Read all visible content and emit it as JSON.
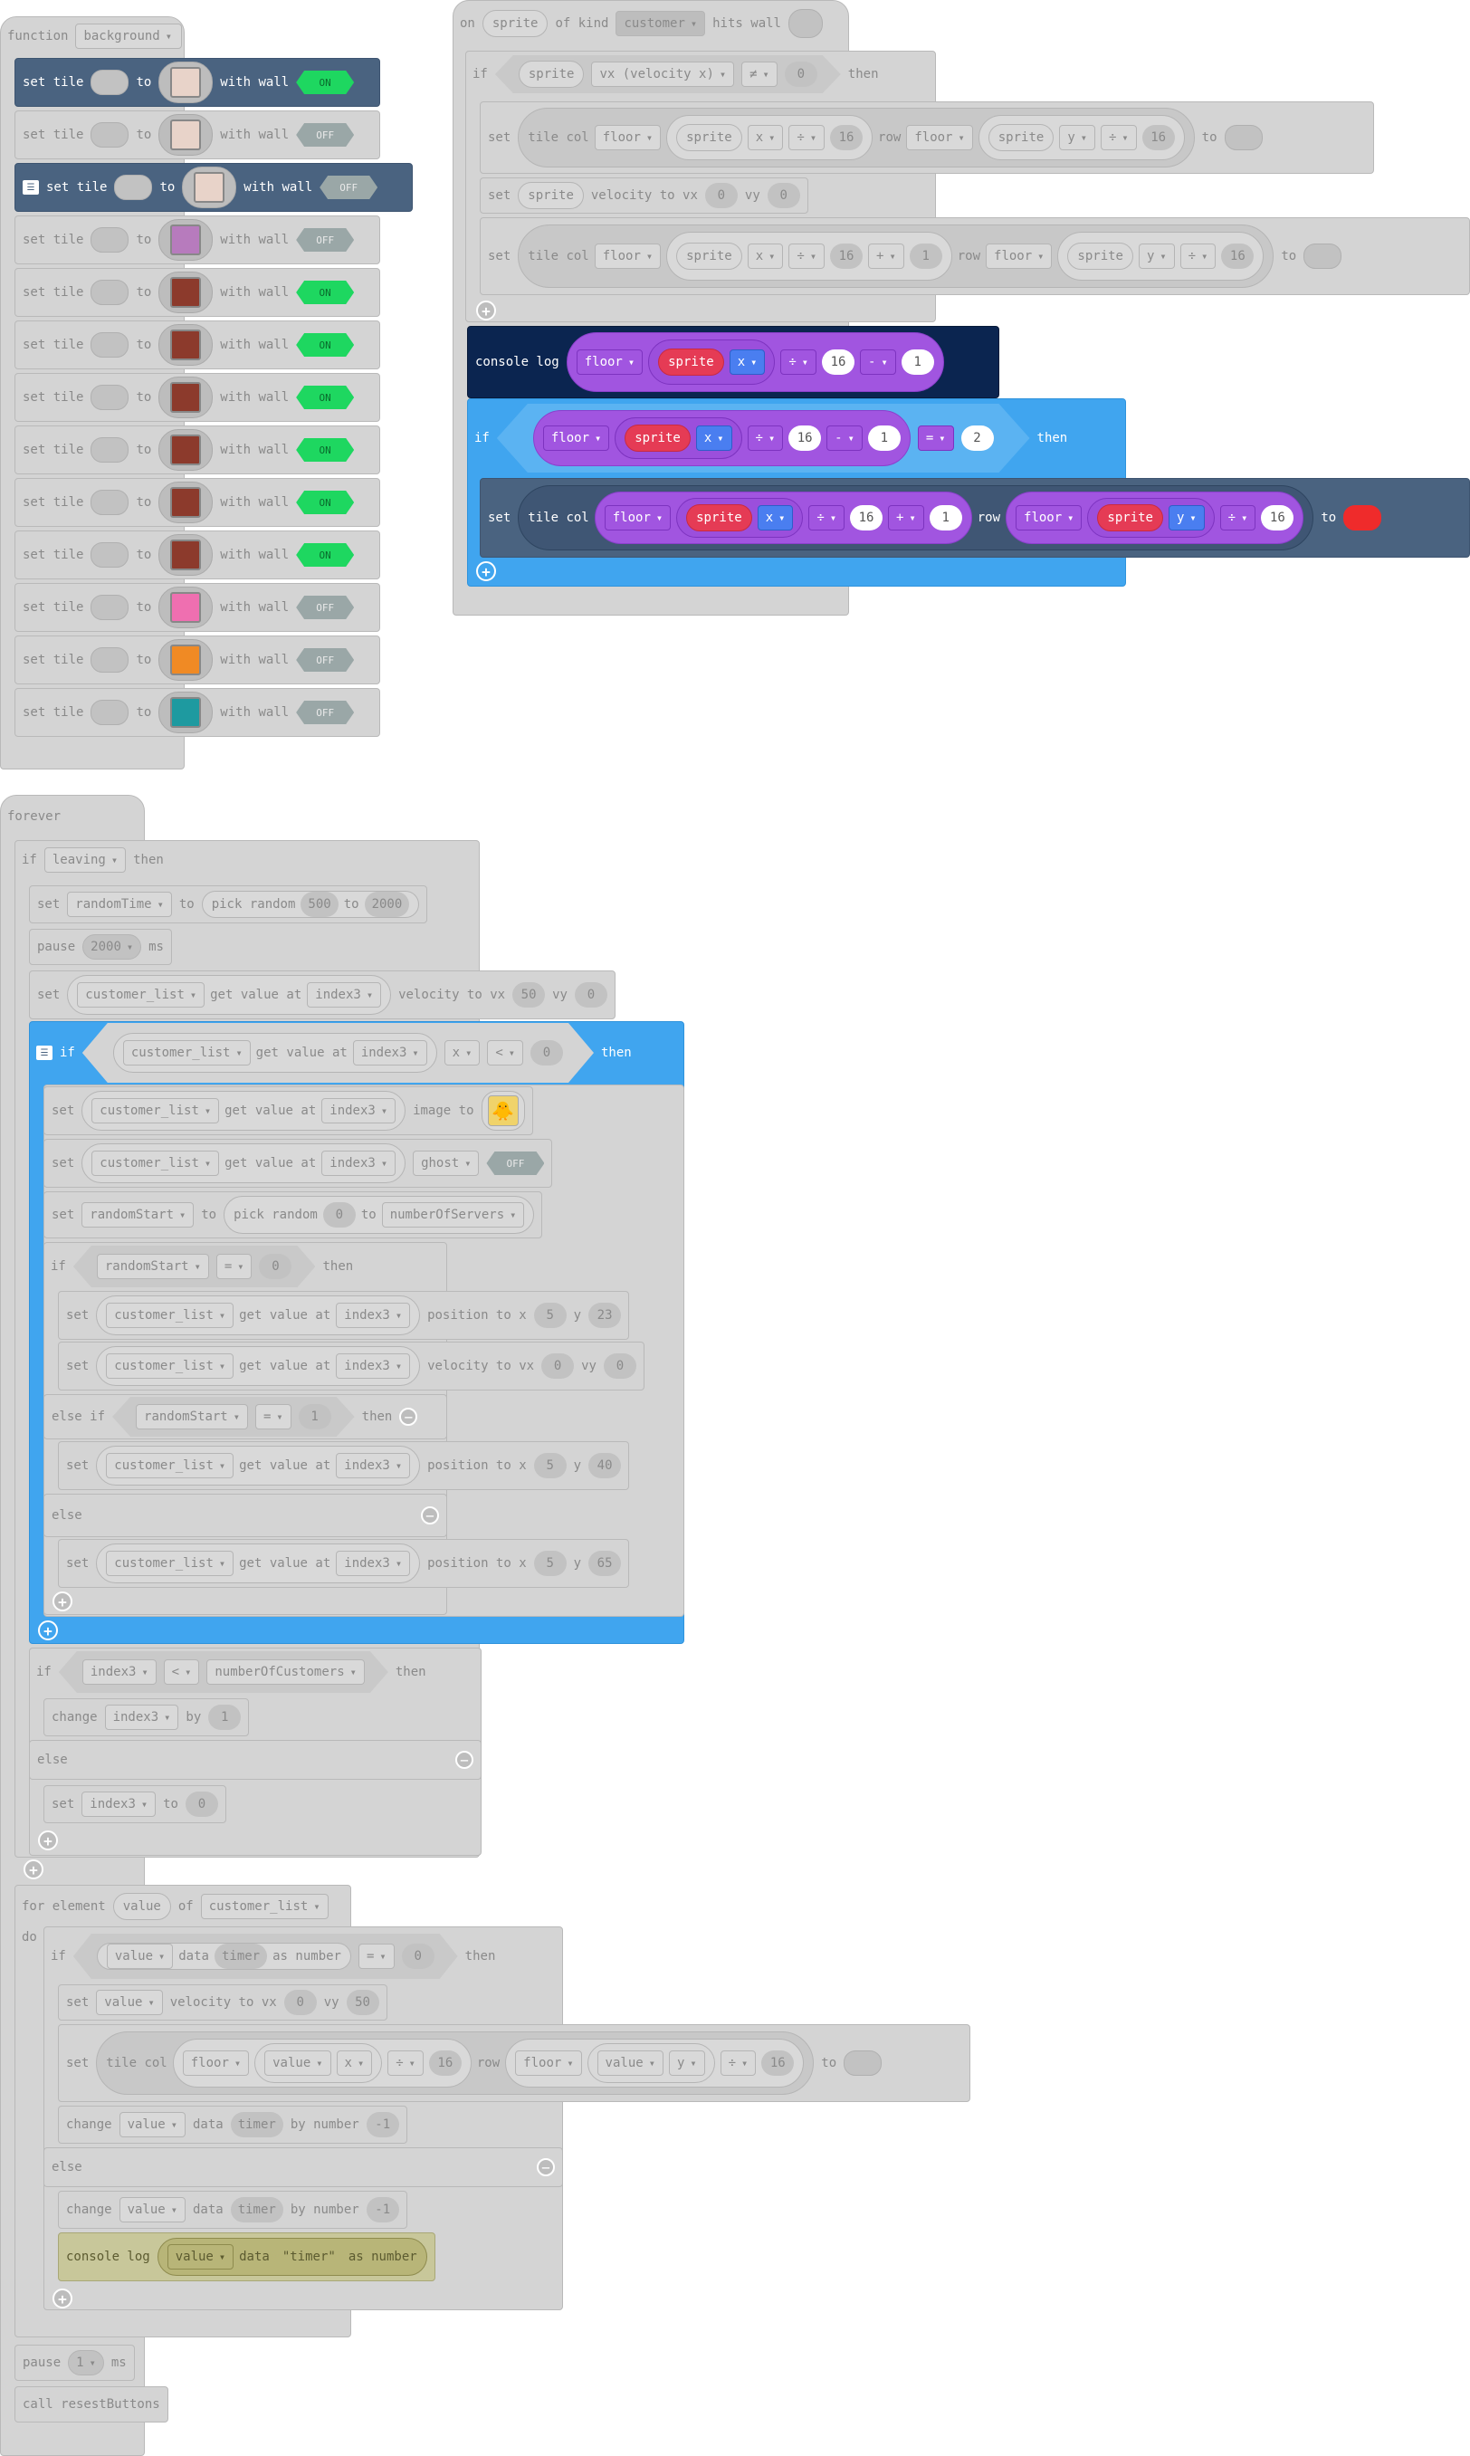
{
  "function_block": {
    "kw_function": "function",
    "name": "background",
    "rows": [
      {
        "set": "set tile",
        "to": "to",
        "with_wall": "with wall",
        "state": "ON",
        "tile_color": "#e8d3c9",
        "highlight": true
      },
      {
        "set": "set tile",
        "to": "to",
        "with_wall": "with wall",
        "state": "OFF",
        "tile_color": "#e8d3c9"
      },
      {
        "set": "set tile",
        "to": "to",
        "with_wall": "with wall",
        "state": "OFF",
        "tile_color": "#e8d3c9",
        "highlight": true
      },
      {
        "set": "set tile",
        "to": "to",
        "with_wall": "with wall",
        "state": "OFF",
        "tile_color": "#b77bbd"
      },
      {
        "set": "set tile",
        "to": "to",
        "with_wall": "with wall",
        "state": "ON",
        "tile_color": "#8c3a2c"
      },
      {
        "set": "set tile",
        "to": "to",
        "with_wall": "with wall",
        "state": "ON",
        "tile_color": "#8c3a2c"
      },
      {
        "set": "set tile",
        "to": "to",
        "with_wall": "with wall",
        "state": "ON",
        "tile_color": "#8c3a2c"
      },
      {
        "set": "set tile",
        "to": "to",
        "with_wall": "with wall",
        "state": "ON",
        "tile_color": "#8c3a2c"
      },
      {
        "set": "set tile",
        "to": "to",
        "with_wall": "with wall",
        "state": "ON",
        "tile_color": "#8c3a2c"
      },
      {
        "set": "set tile",
        "to": "to",
        "with_wall": "with wall",
        "state": "ON",
        "tile_color": "#8c3a2c"
      },
      {
        "set": "set tile",
        "to": "to",
        "with_wall": "with wall",
        "state": "OFF",
        "tile_color": "#ef6fb0"
      },
      {
        "set": "set tile",
        "to": "to",
        "with_wall": "with wall",
        "state": "OFF",
        "tile_color": "#f08a24"
      },
      {
        "set": "set tile",
        "to": "to",
        "with_wall": "with wall",
        "state": "OFF",
        "tile_color": "#1e9aa0"
      }
    ]
  },
  "hits_wall": {
    "on": "on",
    "sprite": "sprite",
    "of_kind": "of kind",
    "kind": "customer",
    "hits_wall": "hits wall",
    "if": "if",
    "vx": "vx (velocity x)",
    "neq": "≠",
    "zero": "0",
    "then": "then",
    "set": "set",
    "tile_col": "tile col",
    "floor": "floor",
    "x": "x",
    "y": "y",
    "div": "÷",
    "sixteen": "16",
    "row": "row",
    "to": "to",
    "velocity_to_vx": "velocity to vx",
    "vy": "vy",
    "plus": "+",
    "one": "1",
    "console_log": "console log",
    "minus": "-",
    "eq": "=",
    "two": "2"
  },
  "forever": {
    "forever": "forever",
    "if": "if",
    "leaving": "leaving",
    "then": "then",
    "set": "set",
    "randomTime": "randomTime",
    "to": "to",
    "pick_random": "pick random",
    "r500": "500",
    "r2000": "2000",
    "pause": "pause",
    "p2000": "2000",
    "ms": "ms",
    "customer_list": "customer_list",
    "get_value_at": "get value at",
    "index3": "index3",
    "velocity_to_vx": "velocity to vx",
    "v50": "50",
    "vy": "vy",
    "zero": "0",
    "x": "x",
    "lt": "<",
    "image_to": "image to",
    "ghost": "ghost",
    "off": "OFF",
    "randomStart": "randomStart",
    "numberOfServers": "numberOfServers",
    "eq": "=",
    "position_to_x": "position to x",
    "five": "5",
    "y": "y",
    "y23": "23",
    "y40": "40",
    "y65": "65",
    "else_if": "else if",
    "one": "1",
    "else": "else",
    "numberOfCustomers": "numberOfCustomers",
    "change": "change",
    "by": "by"
  },
  "for_element": {
    "for_element": "for element",
    "value": "value",
    "of": "of",
    "customer_list": "customer_list",
    "do": "do",
    "if": "if",
    "data": "data",
    "timer": "timer",
    "as_number": "as number",
    "eq": "=",
    "zero": "0",
    "then": "then",
    "set": "set",
    "velocity_to_vx": "velocity to vx",
    "vy": "vy",
    "v50": "50",
    "tile_col": "tile col",
    "floor": "floor",
    "x": "x",
    "y": "y",
    "div": "÷",
    "sixteen": "16",
    "row": "row",
    "to": "to",
    "change": "change",
    "by_number": "by number",
    "neg1": "-1",
    "else": "else",
    "console_log": "console log",
    "timer_str": "\"timer\""
  },
  "footer": {
    "pause": "pause",
    "one": "1",
    "ms": "ms",
    "call": "call resestButtons"
  }
}
